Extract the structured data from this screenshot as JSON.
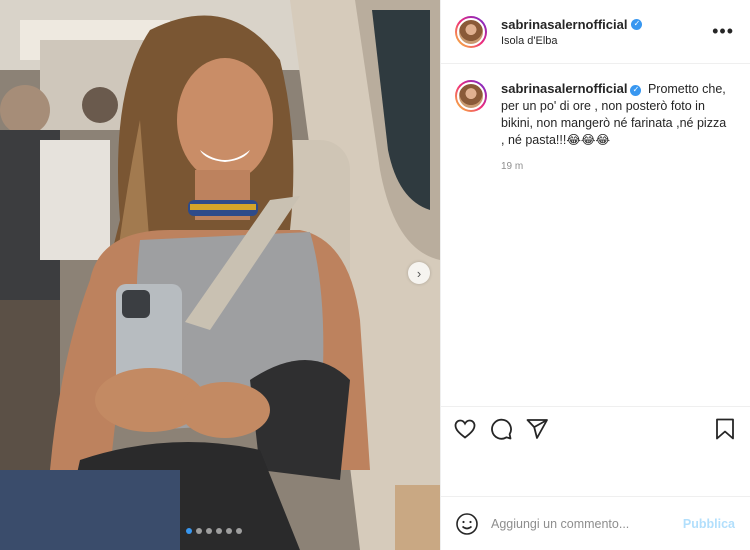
{
  "post": {
    "username": "sabrinasalernofficial",
    "location": "Isola d'Elba",
    "caption_text": "Prometto che, per un po' di ore , non posterò foto in bikini, non mangerò né farinata ,né pizza , né pasta!!!😂😂😂",
    "time": "19 m",
    "verified_glyph": "✓"
  },
  "header": {
    "more_icon": "•••"
  },
  "carousel": {
    "slide_count": 6,
    "active_index": 0,
    "next_glyph": "›"
  },
  "comment": {
    "placeholder": "Aggiungi un commento...",
    "publish_label": "Pubblica"
  },
  "icons": [
    "heart-icon",
    "comment-icon",
    "share-icon",
    "bookmark-icon",
    "emoji-icon"
  ],
  "colors": {
    "verified": "#3897f0",
    "publish_disabled": "#b2dffc",
    "divider": "#efefef"
  }
}
